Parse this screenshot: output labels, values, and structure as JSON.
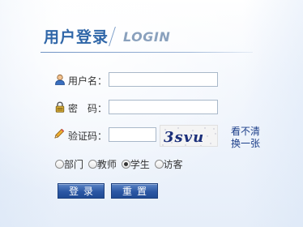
{
  "header": {
    "title_cn": "用户登录",
    "title_en": "LOGIN"
  },
  "form": {
    "username": {
      "label": "用户名：",
      "value": ""
    },
    "password": {
      "label": "密　码：",
      "value": ""
    },
    "captcha": {
      "label": "验证码：",
      "value": "",
      "image_text": "3svu",
      "refresh_line1": "看不清",
      "refresh_line2": "换一张"
    },
    "roles": [
      {
        "label": "部门",
        "checked": false
      },
      {
        "label": "教师",
        "checked": false
      },
      {
        "label": "学生",
        "checked": true
      },
      {
        "label": "访客",
        "checked": false
      }
    ],
    "buttons": {
      "login": "登录",
      "reset": "重置"
    }
  },
  "icons": {
    "username": "user-icon",
    "password": "lock-icon",
    "captcha": "pencil-icon"
  },
  "colors": {
    "title": "#2f66a8",
    "title_en": "#8aa1bd",
    "button": "#2b57a4",
    "link": "#1d3f8a"
  }
}
